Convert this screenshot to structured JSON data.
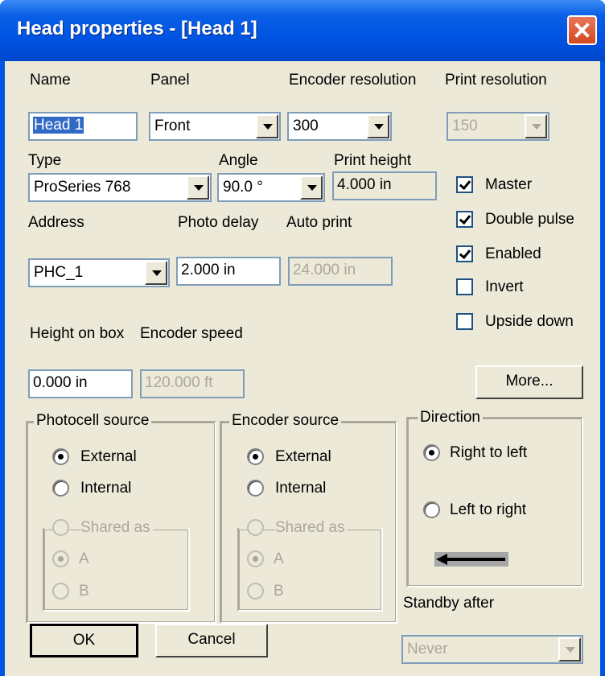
{
  "window": {
    "title": "Head properties - [Head 1]"
  },
  "labels": {
    "name": "Name",
    "panel": "Panel",
    "encoder_resolution": "Encoder resolution",
    "print_resolution": "Print resolution",
    "type": "Type",
    "angle": "Angle",
    "print_height": "Print height",
    "address": "Address",
    "photo_delay": "Photo delay",
    "auto_print": "Auto print",
    "height_on_box": "Height on box",
    "encoder_speed": "Encoder speed",
    "standby_after": "Standby after"
  },
  "fields": {
    "name": "Head 1",
    "print_height": "4.000 in",
    "photo_delay": "2.000 in",
    "auto_print": "24.000 in",
    "height_on_box": "0.000 in",
    "encoder_speed": "120.000 ft"
  },
  "combos": {
    "panel": "Front",
    "encoder_resolution": "300",
    "print_resolution": "150",
    "type": "ProSeries 768",
    "angle": "90.0 °",
    "address": "PHC_1",
    "standby_after": "Never"
  },
  "checkboxes": [
    {
      "label": "Master",
      "checked": true
    },
    {
      "label": "Double pulse",
      "checked": true
    },
    {
      "label": "Enabled",
      "checked": true
    },
    {
      "label": "Invert",
      "checked": false
    },
    {
      "label": "Upside down",
      "checked": false
    }
  ],
  "buttons": {
    "more": "More...",
    "ok": "OK",
    "cancel": "Cancel"
  },
  "photocell_source": {
    "legend": "Photocell source",
    "external": "External",
    "internal": "Internal",
    "shared_as": "Shared as",
    "a": "A",
    "b": "B",
    "selected": "External"
  },
  "encoder_source": {
    "legend": "Encoder source",
    "external": "External",
    "internal": "Internal",
    "shared_as": "Shared as",
    "a": "A",
    "b": "B",
    "selected": "External"
  },
  "direction": {
    "legend": "Direction",
    "right_to_left": "Right to left",
    "left_to_right": "Left to right",
    "selected": "Right to left",
    "arrow_icon": "left-arrow-icon"
  },
  "colors": {
    "titlebar": "#0054e3",
    "dialog_bg": "#ece9d8",
    "selection": "#316ac5",
    "disabled_text": "#aca899"
  }
}
